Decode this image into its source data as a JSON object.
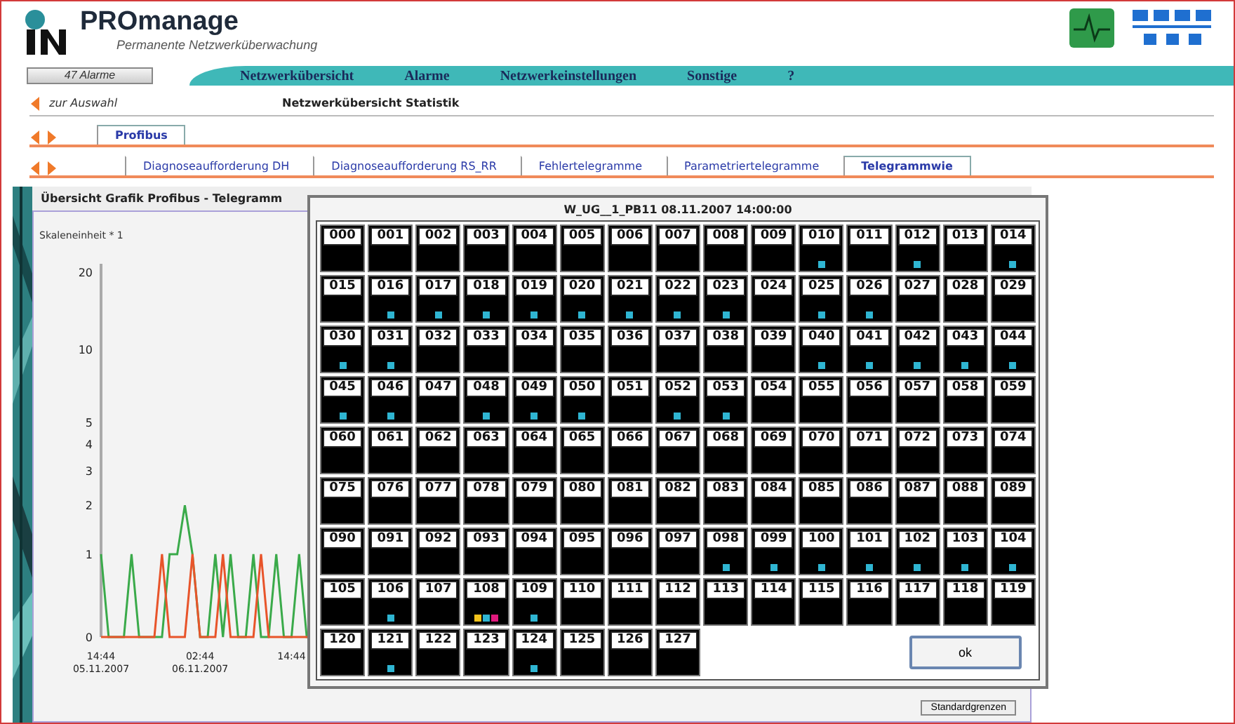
{
  "header": {
    "title": "PROmanage",
    "subtitle": "Permanente Netzwerküberwachung"
  },
  "alarm_button": "47 Alarme",
  "menu": [
    "Netzwerkübersicht",
    "Alarme",
    "Netzwerkeinstellungen",
    "Sonstige",
    "?"
  ],
  "breadcrumb": {
    "back": "zur Auswahl",
    "title": "Netzwerkübersicht Statistik"
  },
  "tabs_level1": [
    {
      "label": "Profibus",
      "selected": true
    }
  ],
  "tabs_level2": [
    {
      "label": "Diagnoseaufforderung DH",
      "selected": false
    },
    {
      "label": "Diagnoseaufforderung RS_RR",
      "selected": false
    },
    {
      "label": "Fehlertelegramme",
      "selected": false
    },
    {
      "label": "Parametriertelegramme",
      "selected": false
    },
    {
      "label": "Telegrammwie",
      "selected": true
    }
  ],
  "panel": {
    "title": "Übersicht Grafik Profibus - Telegramm",
    "footer_button": "Standardgrenzen",
    "chart": {
      "ylabel": "Skaleneinheit * 1",
      "y_labels": [
        "20",
        "10",
        "5",
        "4",
        "3",
        "2",
        "1",
        "0"
      ],
      "x_labels": [
        "14:44 05.11.2007",
        "02:44 06.11.2007",
        "14:44"
      ]
    }
  },
  "dialog": {
    "title": "W_UG__1_PB11 08.11.2007 14:00:00",
    "ok_button": "ok",
    "cells": [
      {
        "label": "000"
      },
      {
        "label": "001"
      },
      {
        "label": "002"
      },
      {
        "label": "003"
      },
      {
        "label": "004"
      },
      {
        "label": "005"
      },
      {
        "label": "006"
      },
      {
        "label": "007"
      },
      {
        "label": "008"
      },
      {
        "label": "009"
      },
      {
        "label": "010",
        "markers": [
          {
            "color": "#2fb5d2"
          }
        ]
      },
      {
        "label": "011"
      },
      {
        "label": "012",
        "markers": [
          {
            "color": "#2fb5d2"
          }
        ]
      },
      {
        "label": "013"
      },
      {
        "label": "014",
        "markers": [
          {
            "color": "#2fb5d2"
          }
        ]
      },
      {
        "label": "015"
      },
      {
        "label": "016",
        "markers": [
          {
            "color": "#2fb5d2"
          }
        ]
      },
      {
        "label": "017",
        "markers": [
          {
            "color": "#2fb5d2"
          }
        ]
      },
      {
        "label": "018",
        "markers": [
          {
            "color": "#2fb5d2"
          }
        ]
      },
      {
        "label": "019",
        "markers": [
          {
            "color": "#2fb5d2"
          }
        ]
      },
      {
        "label": "020",
        "markers": [
          {
            "color": "#2fb5d2"
          }
        ]
      },
      {
        "label": "021",
        "markers": [
          {
            "color": "#2fb5d2"
          }
        ]
      },
      {
        "label": "022",
        "markers": [
          {
            "color": "#2fb5d2"
          }
        ]
      },
      {
        "label": "023",
        "markers": [
          {
            "color": "#2fb5d2"
          }
        ]
      },
      {
        "label": "024"
      },
      {
        "label": "025",
        "markers": [
          {
            "color": "#2fb5d2"
          }
        ]
      },
      {
        "label": "026",
        "markers": [
          {
            "color": "#2fb5d2"
          }
        ]
      },
      {
        "label": "027"
      },
      {
        "label": "028"
      },
      {
        "label": "029"
      },
      {
        "label": "030",
        "markers": [
          {
            "color": "#2fb5d2"
          }
        ]
      },
      {
        "label": "031",
        "markers": [
          {
            "color": "#2fb5d2"
          }
        ]
      },
      {
        "label": "032"
      },
      {
        "label": "033"
      },
      {
        "label": "034"
      },
      {
        "label": "035"
      },
      {
        "label": "036"
      },
      {
        "label": "037"
      },
      {
        "label": "038"
      },
      {
        "label": "039"
      },
      {
        "label": "040",
        "markers": [
          {
            "color": "#2fb5d2"
          }
        ]
      },
      {
        "label": "041",
        "markers": [
          {
            "color": "#2fb5d2"
          }
        ]
      },
      {
        "label": "042",
        "markers": [
          {
            "color": "#2fb5d2"
          }
        ]
      },
      {
        "label": "043",
        "markers": [
          {
            "color": "#2fb5d2"
          }
        ]
      },
      {
        "label": "044",
        "markers": [
          {
            "color": "#2fb5d2"
          }
        ]
      },
      {
        "label": "045",
        "markers": [
          {
            "color": "#2fb5d2"
          }
        ]
      },
      {
        "label": "046",
        "markers": [
          {
            "color": "#2fb5d2"
          }
        ]
      },
      {
        "label": "047"
      },
      {
        "label": "048",
        "markers": [
          {
            "color": "#2fb5d2"
          }
        ]
      },
      {
        "label": "049",
        "markers": [
          {
            "color": "#2fb5d2"
          }
        ]
      },
      {
        "label": "050",
        "markers": [
          {
            "color": "#2fb5d2"
          }
        ]
      },
      {
        "label": "051"
      },
      {
        "label": "052",
        "markers": [
          {
            "color": "#2fb5d2"
          }
        ]
      },
      {
        "label": "053",
        "markers": [
          {
            "color": "#2fb5d2"
          }
        ]
      },
      {
        "label": "054"
      },
      {
        "label": "055"
      },
      {
        "label": "056"
      },
      {
        "label": "057"
      },
      {
        "label": "058"
      },
      {
        "label": "059"
      },
      {
        "label": "060"
      },
      {
        "label": "061"
      },
      {
        "label": "062"
      },
      {
        "label": "063"
      },
      {
        "label": "064"
      },
      {
        "label": "065"
      },
      {
        "label": "066"
      },
      {
        "label": "067"
      },
      {
        "label": "068"
      },
      {
        "label": "069"
      },
      {
        "label": "070"
      },
      {
        "label": "071"
      },
      {
        "label": "072"
      },
      {
        "label": "073"
      },
      {
        "label": "074"
      },
      {
        "label": "075"
      },
      {
        "label": "076"
      },
      {
        "label": "077"
      },
      {
        "label": "078"
      },
      {
        "label": "079"
      },
      {
        "label": "080"
      },
      {
        "label": "081"
      },
      {
        "label": "082"
      },
      {
        "label": "083"
      },
      {
        "label": "084"
      },
      {
        "label": "085"
      },
      {
        "label": "086"
      },
      {
        "label": "087"
      },
      {
        "label": "088"
      },
      {
        "label": "089"
      },
      {
        "label": "090"
      },
      {
        "label": "091"
      },
      {
        "label": "092"
      },
      {
        "label": "093"
      },
      {
        "label": "094"
      },
      {
        "label": "095"
      },
      {
        "label": "096"
      },
      {
        "label": "097"
      },
      {
        "label": "098",
        "markers": [
          {
            "color": "#2fb5d2"
          }
        ]
      },
      {
        "label": "099",
        "markers": [
          {
            "color": "#2fb5d2"
          }
        ]
      },
      {
        "label": "100",
        "markers": [
          {
            "color": "#2fb5d2"
          }
        ]
      },
      {
        "label": "101",
        "markers": [
          {
            "color": "#2fb5d2"
          }
        ]
      },
      {
        "label": "102",
        "markers": [
          {
            "color": "#2fb5d2"
          }
        ]
      },
      {
        "label": "103",
        "markers": [
          {
            "color": "#2fb5d2"
          }
        ]
      },
      {
        "label": "104",
        "markers": [
          {
            "color": "#2fb5d2"
          }
        ]
      },
      {
        "label": "105"
      },
      {
        "label": "106",
        "markers": [
          {
            "color": "#2fb5d2"
          }
        ]
      },
      {
        "label": "107"
      },
      {
        "label": "108",
        "markers": [
          {
            "color": "#f2c21b"
          },
          {
            "color": "#2fb5d2"
          },
          {
            "color": "#e0197d"
          }
        ]
      },
      {
        "label": "109",
        "markers": [
          {
            "color": "#2fb5d2"
          }
        ]
      },
      {
        "label": "110"
      },
      {
        "label": "111"
      },
      {
        "label": "112"
      },
      {
        "label": "113"
      },
      {
        "label": "114"
      },
      {
        "label": "115"
      },
      {
        "label": "116"
      },
      {
        "label": "117"
      },
      {
        "label": "118"
      },
      {
        "label": "119"
      },
      {
        "label": "120"
      },
      {
        "label": "121",
        "markers": [
          {
            "color": "#2fb5d2"
          }
        ]
      },
      {
        "label": "122"
      },
      {
        "label": "123"
      },
      {
        "label": "124",
        "markers": [
          {
            "color": "#2fb5d2"
          }
        ]
      },
      {
        "label": "125"
      },
      {
        "label": "126"
      },
      {
        "label": "127"
      }
    ]
  }
}
